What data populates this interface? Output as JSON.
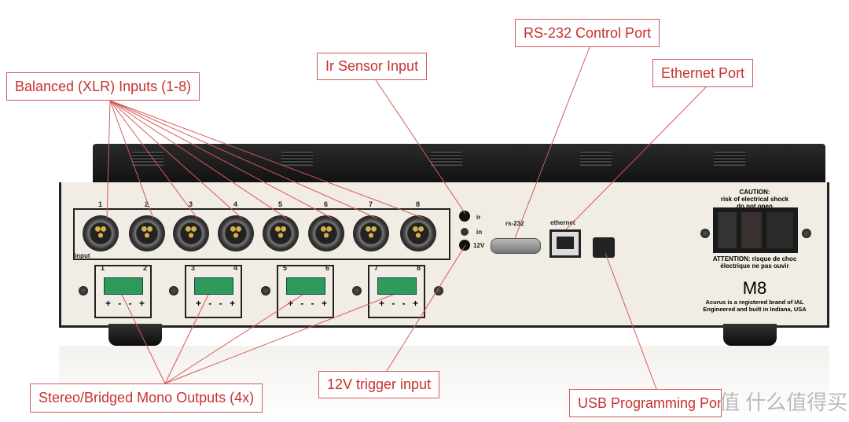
{
  "labels": {
    "balanced_inputs": "Balanced (XLR) Inputs (1-8)",
    "ir_sensor": "Ir Sensor Input",
    "rs232": "RS-232 Control Port",
    "ethernet": "Ethernet Port",
    "stereo_outputs": "Stereo/Bridged Mono Outputs (4x)",
    "trigger": "12V trigger input",
    "usb": "USB Programming Port"
  },
  "device": {
    "input_numbers": [
      "1",
      "2",
      "3",
      "4",
      "5",
      "6",
      "7",
      "8"
    ],
    "input_label": "input",
    "output_pairs": [
      [
        "1",
        "2"
      ],
      [
        "3",
        "4"
      ],
      [
        "5",
        "6"
      ],
      [
        "7",
        "8"
      ]
    ],
    "terminal_polarity": "+ - - +",
    "ir": "ir",
    "in": "in",
    "v12": "12V",
    "rs232": "rs-232",
    "ethernet": "ethernet",
    "caution": "CAUTION:",
    "caution2": "risk of electrical shock",
    "caution3": "do not open",
    "attention": "ATTENTION: risque de choc",
    "attention2": "électrique ne pas ouvir",
    "model": "M8",
    "brand1": "Acurus is a registered brand of IAL",
    "brand2": "Engineered and built in Indiana, USA"
  },
  "watermark": "值 什么值得买",
  "colors": {
    "accent": "#c8312f",
    "terminal": "#2f9a5a"
  }
}
